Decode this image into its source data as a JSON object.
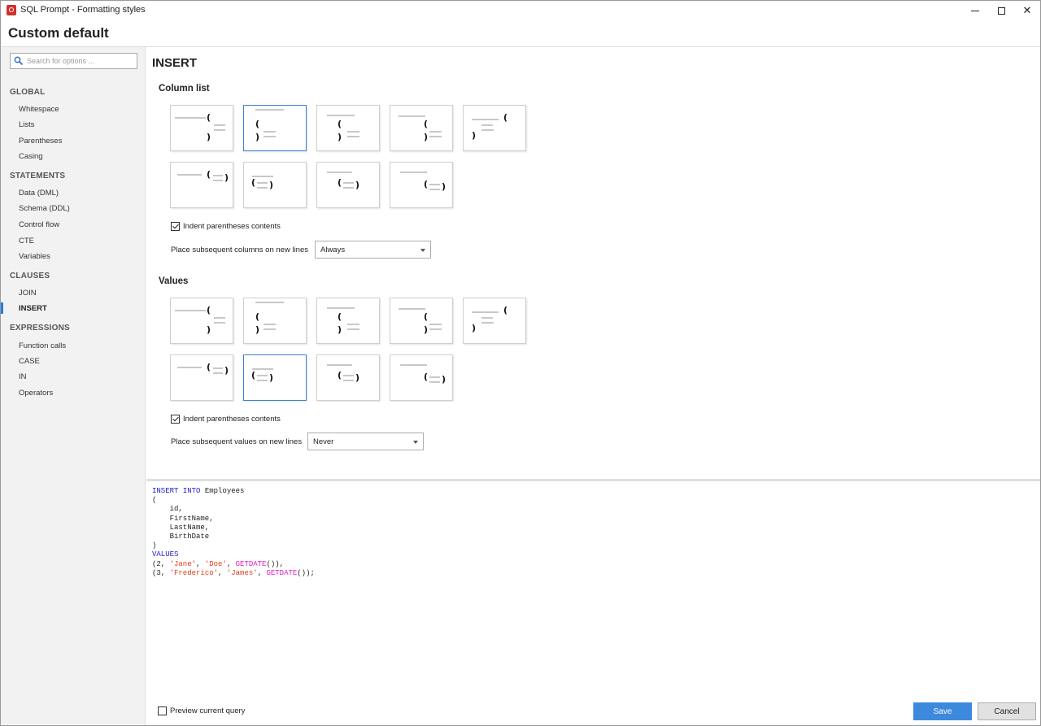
{
  "window": {
    "title": "SQL Prompt - Formatting styles",
    "style_name": "Custom default"
  },
  "sidebar": {
    "search_placeholder": "Search for options ...",
    "sections": [
      {
        "label": "GLOBAL",
        "items": [
          "Whitespace",
          "Lists",
          "Parentheses",
          "Casing"
        ]
      },
      {
        "label": "STATEMENTS",
        "items": [
          "Data (DML)",
          "Schema (DDL)",
          "Control flow",
          "CTE",
          "Variables"
        ]
      },
      {
        "label": "CLAUSES",
        "items": [
          "JOIN",
          "INSERT"
        ]
      },
      {
        "label": "EXPRESSIONS",
        "items": [
          "Function calls",
          "CASE",
          "IN",
          "Operators"
        ]
      }
    ],
    "active_item": "INSERT"
  },
  "main": {
    "heading": "INSERT",
    "column_list": {
      "heading": "Column list",
      "selected_style_index": 1,
      "indent_label": "Indent parentheses contents",
      "indent_checked": true,
      "placement_label": "Place subsequent columns on new lines",
      "placement_value": "Always"
    },
    "values": {
      "heading": "Values",
      "selected_style_index": 6,
      "indent_label": "Indent parentheses contents",
      "indent_checked": true,
      "placement_label": "Place subsequent values on new lines",
      "placement_value": "Never"
    }
  },
  "preview": {
    "code_lines": [
      [
        {
          "t": "INSERT INTO",
          "c": "kw"
        },
        {
          "t": " Employees",
          "c": ""
        }
      ],
      [
        {
          "t": "(",
          "c": ""
        }
      ],
      [
        {
          "t": "    id,",
          "c": ""
        }
      ],
      [
        {
          "t": "    FirstName,",
          "c": ""
        }
      ],
      [
        {
          "t": "    LastName,",
          "c": ""
        }
      ],
      [
        {
          "t": "    BirthDate",
          "c": ""
        }
      ],
      [
        {
          "t": ")",
          "c": ""
        }
      ],
      [
        {
          "t": "VALUES",
          "c": "kw"
        }
      ],
      [
        {
          "t": "(2, ",
          "c": ""
        },
        {
          "t": "'Jane'",
          "c": "str"
        },
        {
          "t": ", ",
          "c": ""
        },
        {
          "t": "'Doe'",
          "c": "str"
        },
        {
          "t": ", ",
          "c": ""
        },
        {
          "t": "GETDATE",
          "c": "fn"
        },
        {
          "t": "()),",
          "c": ""
        }
      ],
      [
        {
          "t": "(3, ",
          "c": ""
        },
        {
          "t": "'Frederico'",
          "c": "str"
        },
        {
          "t": ", ",
          "c": ""
        },
        {
          "t": "'James'",
          "c": "str"
        },
        {
          "t": ", ",
          "c": ""
        },
        {
          "t": "GETDATE",
          "c": "fn"
        },
        {
          "t": "());",
          "c": ""
        }
      ]
    ]
  },
  "footer": {
    "preview_label": "Preview current query",
    "preview_checked": false,
    "save_label": "Save",
    "cancel_label": "Cancel"
  },
  "colors": {
    "accent": "#3c89dd",
    "selected_tile_border": "#3a7fd6",
    "keyword": "#1e1ec8",
    "string": "#e0401f",
    "function": "#e01ec8"
  }
}
